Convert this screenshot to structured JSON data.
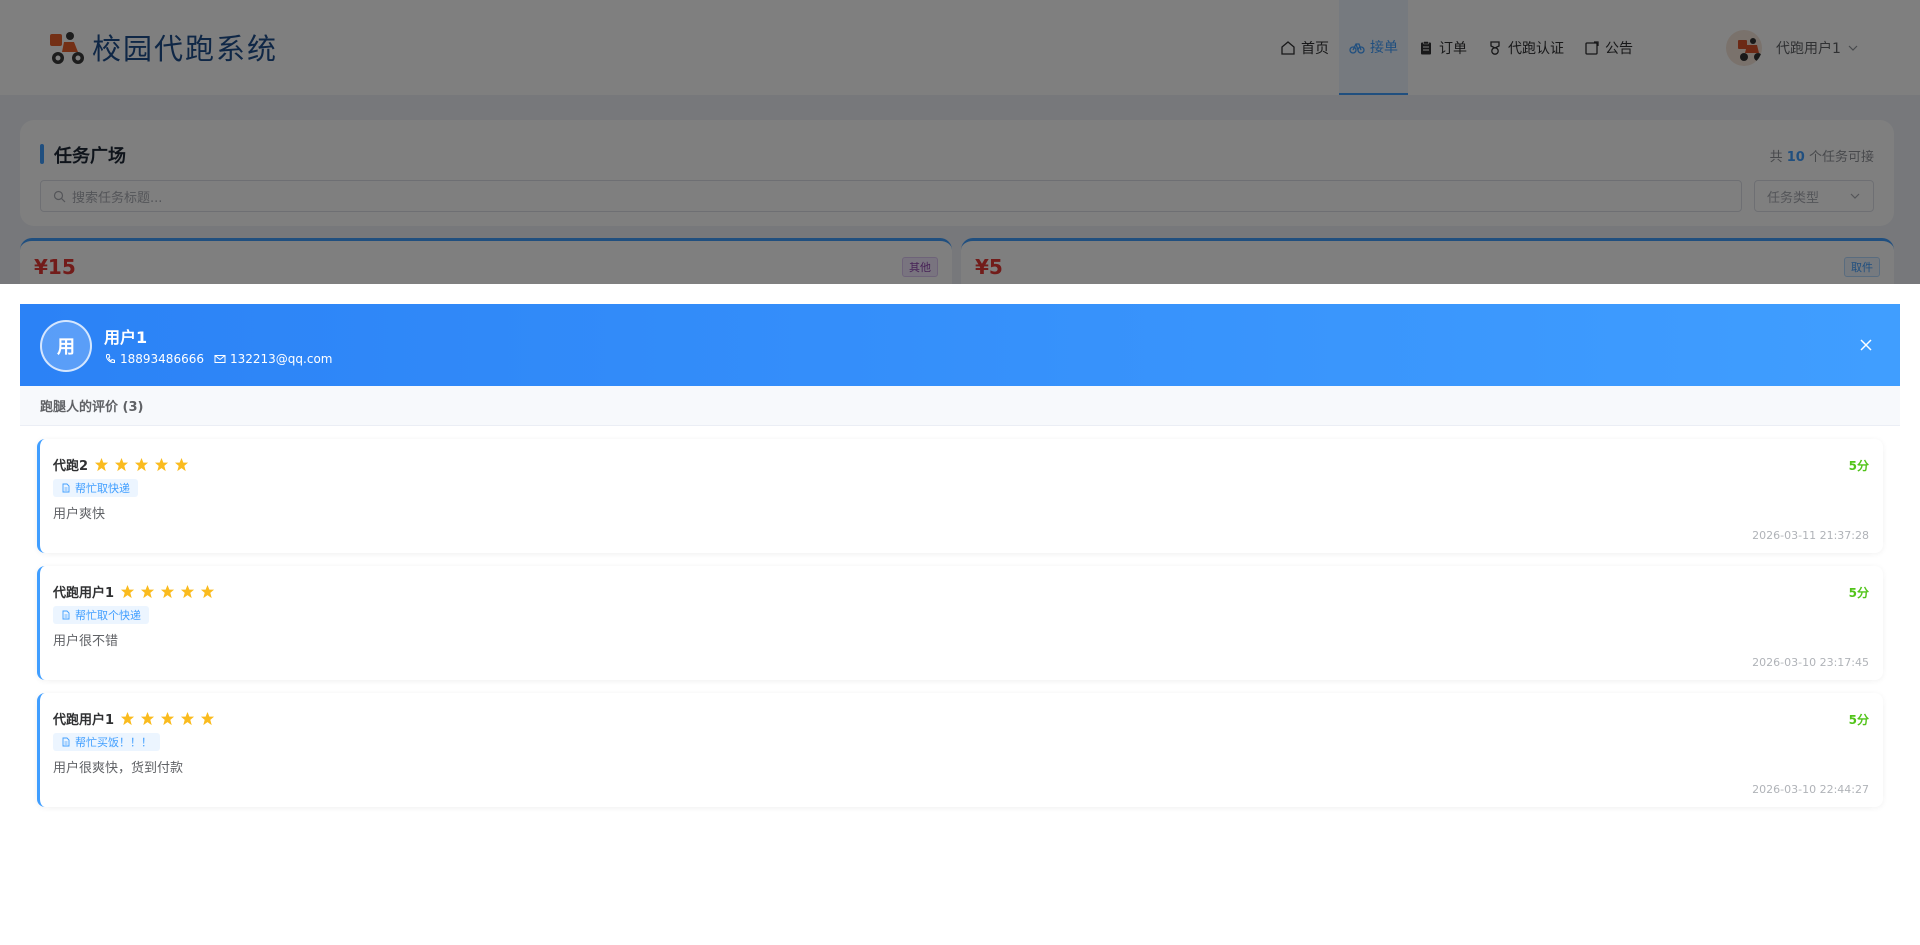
{
  "app": {
    "title": "校园代跑系统"
  },
  "nav": {
    "items": [
      {
        "label": "首页",
        "icon": "home-icon"
      },
      {
        "label": "接单",
        "icon": "bicycle-icon"
      },
      {
        "label": "订单",
        "icon": "clipboard-icon"
      },
      {
        "label": "代跑认证",
        "icon": "medal-icon"
      },
      {
        "label": "公告",
        "icon": "notice-icon"
      }
    ],
    "active": "接单"
  },
  "user": {
    "name": "代跑用户1"
  },
  "tasks": {
    "title": "任务广场",
    "count_prefix": "共",
    "count": "10",
    "count_suffix": "个任务可接",
    "search_placeholder": "搜索任务标题...",
    "type_placeholder": "任务类型",
    "cards": [
      {
        "price": "¥15",
        "tag": "其他"
      },
      {
        "price": "¥5",
        "tag": "取件"
      }
    ]
  },
  "dialog": {
    "avatar_text": "用",
    "name": "用户1",
    "phone": "18893486666",
    "email": "132213@qq.com",
    "section_title": "跑腿人的评价 (3)",
    "reviews": [
      {
        "reviewer": "代跑2",
        "stars": 5,
        "score": "5分",
        "task": "帮忙取快递",
        "text": "用户爽快",
        "time": "2026-03-11 21:37:28"
      },
      {
        "reviewer": "代跑用户1",
        "stars": 5,
        "score": "5分",
        "task": "帮忙取个快递",
        "text": "用户很不错",
        "time": "2026-03-10 23:17:45"
      },
      {
        "reviewer": "代跑用户1",
        "stars": 5,
        "score": "5分",
        "task": "帮忙买饭！！！",
        "text": "用户很爽快，货到付款",
        "time": "2026-03-10 22:44:27"
      }
    ]
  },
  "colors": {
    "primary": "#409eff",
    "header_gradient_start": "#2b82f6",
    "score_green": "#52c41a",
    "star": "#fabb1e",
    "price_red": "#e53935"
  }
}
